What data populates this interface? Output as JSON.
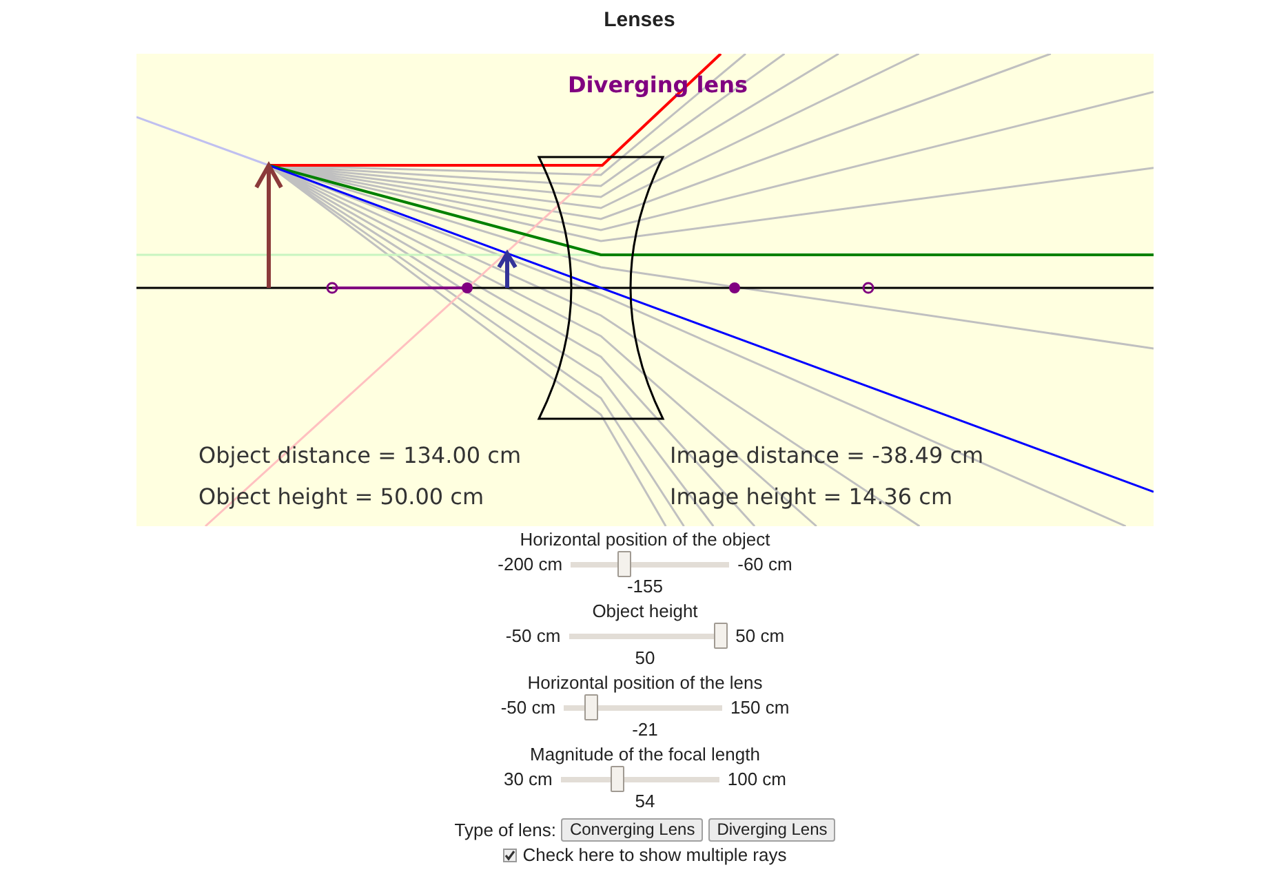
{
  "title": "Lenses",
  "diagram": {
    "lens_label": "Diverging lens",
    "object_distance": "Object distance = 134.00 cm",
    "object_height": "Object height = 50.00 cm",
    "image_distance": "Image distance = -38.49 cm",
    "image_height": "Image height = 14.36 cm"
  },
  "sliders": [
    {
      "label": "Horizontal position of the object",
      "min": "-200 cm",
      "max": "-60 cm",
      "value": "-155",
      "level": 0.32
    },
    {
      "label": "Object height",
      "min": "-50 cm",
      "max": "50 cm",
      "value": "50",
      "level": 1
    },
    {
      "label": "Horizontal position of the lens",
      "min": "-50 cm",
      "max": "150 cm",
      "value": "-21",
      "level": 0.145
    },
    {
      "label": "Magnitude of the focal length",
      "min": "30 cm",
      "max": "100 cm",
      "value": "54",
      "level": 0.34
    }
  ],
  "lens_type": {
    "label": "Type of lens:",
    "buttons": [
      "Converging Lens",
      "Diverging Lens"
    ]
  },
  "multiple_rays": {
    "label": "Check here to show multiple rays",
    "checked": true
  }
}
